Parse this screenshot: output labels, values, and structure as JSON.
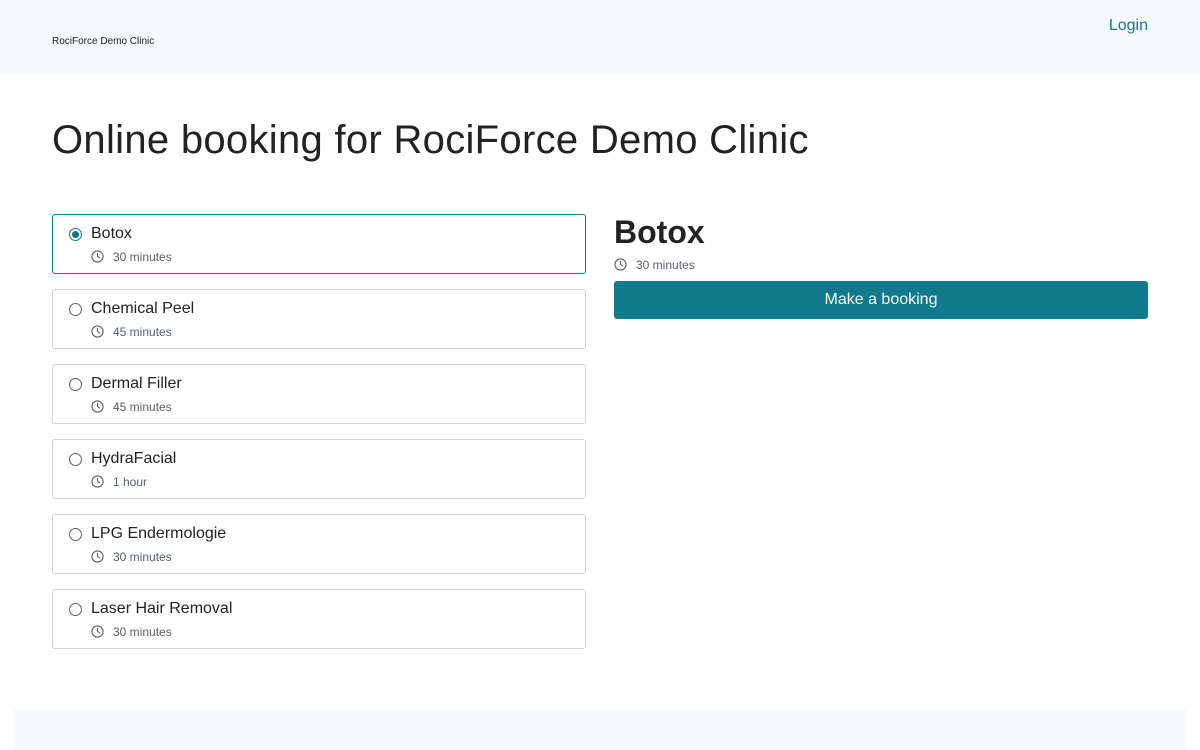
{
  "header": {
    "clinic_name": "RociForce Demo Clinic",
    "login_label": "Login"
  },
  "page_title": "Online booking for RociForce Demo Clinic",
  "services": [
    {
      "name": "Botox",
      "duration": "30 minutes",
      "selected": true
    },
    {
      "name": "Chemical Peel",
      "duration": "45 minutes",
      "selected": false
    },
    {
      "name": "Dermal Filler",
      "duration": "45 minutes",
      "selected": false
    },
    {
      "name": "HydraFacial",
      "duration": "1 hour",
      "selected": false
    },
    {
      "name": "LPG Endermologie",
      "duration": "30 minutes",
      "selected": false
    },
    {
      "name": "Laser Hair Removal",
      "duration": "30 minutes",
      "selected": false
    }
  ],
  "detail": {
    "title": "Botox",
    "duration": "30 minutes",
    "button_label": "Make a booking"
  },
  "colors": {
    "accent": "#107a8c",
    "header_bg": "#f8f9fb"
  }
}
